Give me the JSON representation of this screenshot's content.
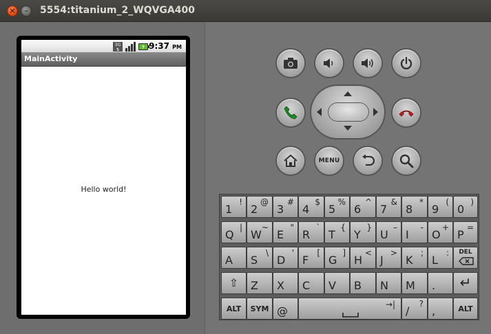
{
  "window": {
    "title": "5554:titanium_2_WQVGA400",
    "close_glyph": "×",
    "minimize_glyph": "–"
  },
  "statusbar": {
    "time": "9:37",
    "ampm": "PM",
    "network": "3G"
  },
  "app": {
    "title": "MainActivity",
    "content_text": "Hello world!"
  },
  "controls": {
    "menu_label": "MENU"
  },
  "keyboard": {
    "row1": [
      {
        "main": "1",
        "alt": "!"
      },
      {
        "main": "2",
        "alt": "@"
      },
      {
        "main": "3",
        "alt": "#"
      },
      {
        "main": "4",
        "alt": "$"
      },
      {
        "main": "5",
        "alt": "%"
      },
      {
        "main": "6",
        "alt": "^"
      },
      {
        "main": "7",
        "alt": "&"
      },
      {
        "main": "8",
        "alt": "*"
      },
      {
        "main": "9",
        "alt": "("
      },
      {
        "main": "0",
        "alt": ")"
      }
    ],
    "row2": [
      {
        "main": "Q",
        "alt": "|"
      },
      {
        "main": "W",
        "alt": "~"
      },
      {
        "main": "E",
        "alt": "\""
      },
      {
        "main": "R",
        "alt": "`"
      },
      {
        "main": "T",
        "alt": "{"
      },
      {
        "main": "Y",
        "alt": "}"
      },
      {
        "main": "U",
        "alt": "–"
      },
      {
        "main": "I",
        "alt": "-"
      },
      {
        "main": "O",
        "alt": "+"
      },
      {
        "main": "P",
        "alt": "="
      }
    ],
    "row3": [
      {
        "main": "A",
        "alt": ""
      },
      {
        "main": "S",
        "alt": "\\"
      },
      {
        "main": "D",
        "alt": "'"
      },
      {
        "main": "F",
        "alt": "["
      },
      {
        "main": "G",
        "alt": "]"
      },
      {
        "main": "H",
        "alt": "<"
      },
      {
        "main": "J",
        "alt": ">"
      },
      {
        "main": "K",
        "alt": ";"
      },
      {
        "main": "L",
        "alt": ":"
      },
      {
        "main": "DEL",
        "alt": ""
      }
    ],
    "row4": [
      {
        "main": "⇧",
        "alt": ""
      },
      {
        "main": "Z",
        "alt": ""
      },
      {
        "main": "X",
        "alt": ""
      },
      {
        "main": "C",
        "alt": ""
      },
      {
        "main": "V",
        "alt": ""
      },
      {
        "main": "B",
        "alt": ""
      },
      {
        "main": "N",
        "alt": ""
      },
      {
        "main": "M",
        "alt": ""
      },
      {
        "main": ".",
        "alt": ""
      },
      {
        "main": "↵",
        "alt": ""
      }
    ],
    "row5": {
      "alt_left": "ALT",
      "sym": "SYM",
      "at": "@",
      "space_tab": "→|",
      "slash": "/",
      "question": "?",
      "comma": ",",
      "alt_right": "ALT"
    }
  }
}
